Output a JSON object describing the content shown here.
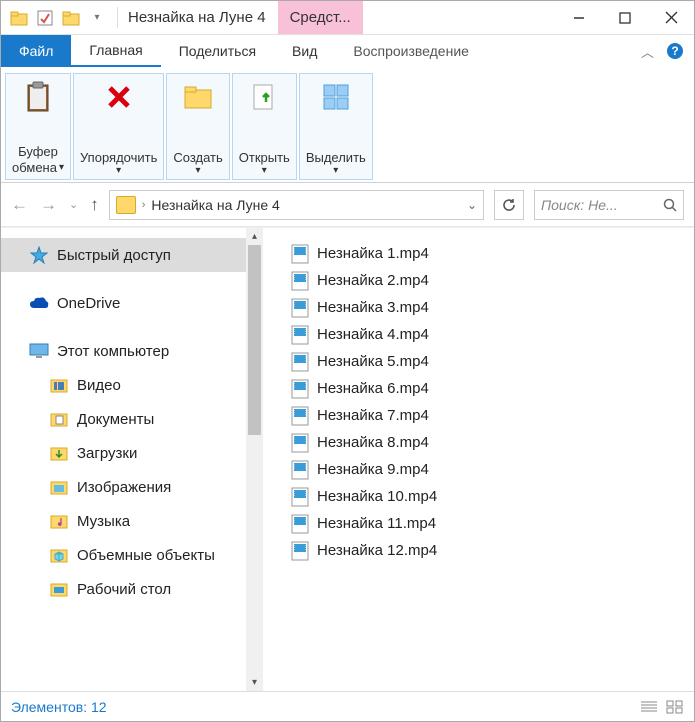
{
  "title": "Незнайка на Луне 4",
  "context_tab_label": "Средст...",
  "tabs": {
    "file": "Файл",
    "home": "Главная",
    "share": "Поделиться",
    "view": "Вид",
    "playback": "Воспроизведение"
  },
  "ribbon": {
    "clipboard": "Буфер\nобмена",
    "organize": "Упорядочить",
    "create": "Создать",
    "open": "Открыть",
    "select": "Выделить"
  },
  "breadcrumb": {
    "path": "Незнайка на Луне 4"
  },
  "search": {
    "placeholder": "Поиск: Не..."
  },
  "sidebar": {
    "quick_access": "Быстрый доступ",
    "onedrive": "OneDrive",
    "this_pc": "Этот компьютер",
    "videos": "Видео",
    "documents": "Документы",
    "downloads": "Загрузки",
    "pictures": "Изображения",
    "music": "Музыка",
    "objects3d": "Объемные объекты",
    "desktop": "Рабочий стол"
  },
  "files": [
    "Незнайка 1.mp4",
    "Незнайка 2.mp4",
    "Незнайка 3.mp4",
    "Незнайка 4.mp4",
    "Незнайка 5.mp4",
    "Незнайка 6.mp4",
    "Незнайка 7.mp4",
    "Незнайка 8.mp4",
    "Незнайка 9.mp4",
    "Незнайка 10.mp4",
    "Незнайка 11.mp4",
    "Незнайка 12.mp4"
  ],
  "status": {
    "label": "Элементов:",
    "count": "12"
  }
}
